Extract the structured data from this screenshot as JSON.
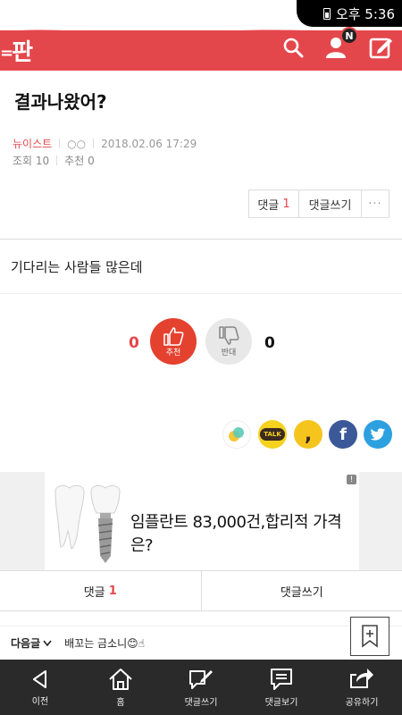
{
  "status_bar": {
    "time_label": "오후 5:36"
  },
  "header": {
    "logo_text": "판",
    "notification_badge": "N",
    "brand_color": "#e4474b"
  },
  "post": {
    "title": "결과나왔어?",
    "author": "뉴이스트",
    "nickname": "○○",
    "datetime": "2018.02.06 17:29",
    "views_label": "조회 10",
    "recommend_label": "추천 0",
    "comment_button_label": "댓글",
    "comment_count": "1",
    "write_comment_label": "댓글쓰기",
    "more_label": "···",
    "body": "기다리는 사람들 많은데"
  },
  "vote": {
    "up_count": "0",
    "up_label": "추천",
    "down_label": "반대",
    "down_count": "0"
  },
  "share": {
    "items": [
      "kakaostory-icon",
      "kakaotalk-icon",
      "kakaopage-icon",
      "facebook-icon",
      "twitter-icon"
    ],
    "talk_label": "TALK"
  },
  "ad": {
    "text": "임플란트 83,000건,합리적 가격은?",
    "info_label": "!"
  },
  "comment_bar": {
    "comments_label": "댓글",
    "comments_count": "1",
    "write_label": "댓글쓰기"
  },
  "next_post": {
    "label": "다음글",
    "title": "배꼬는 금소니😊☝"
  },
  "bottom_nav": [
    {
      "label": "이전",
      "icon": "back-icon"
    },
    {
      "label": "홈",
      "icon": "home-icon"
    },
    {
      "label": "댓글쓰기",
      "icon": "write-comment-icon"
    },
    {
      "label": "댓글보기",
      "icon": "view-comments-icon"
    },
    {
      "label": "공유하기",
      "icon": "share-icon"
    }
  ]
}
